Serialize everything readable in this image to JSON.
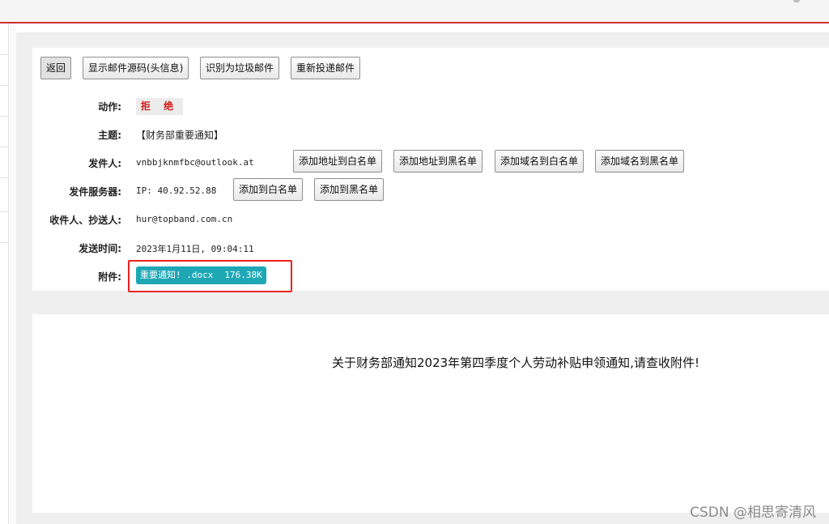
{
  "toolbar": {
    "back_label": "返回",
    "show_source_label": "显示邮件源码(头信息)",
    "mark_spam_label": "识别为垃圾邮件",
    "redeliver_label": "重新投递邮件"
  },
  "details": {
    "action": {
      "label": "动作:",
      "value": "拒 绝"
    },
    "subject": {
      "label": "主题:",
      "value": "【财务部重要通知】"
    },
    "sender": {
      "label": "发件人:",
      "value": "vnbbjknmfbc@outlook.at",
      "buttons": [
        "添加地址到白名单",
        "添加地址到黑名单",
        "添加域名到白名单",
        "添加域名到黑名单"
      ]
    },
    "server": {
      "label": "发件服务器:",
      "value": "IP: 40.92.52.88",
      "buttons": [
        "添加到白名单",
        "添加到黑名单"
      ]
    },
    "recipients": {
      "label": "收件人、抄送人:",
      "value": "hur@topband.com.cn"
    },
    "sent_time": {
      "label": "发送时间:",
      "value": "2023年1月11日, 09:04:11"
    },
    "attachment": {
      "label": "附件:",
      "name": "重要通知! .docx",
      "size": "176.38K"
    }
  },
  "body": {
    "text": "关于财务部通知2023年第四季度个人劳动补贴申领通知,请查收附件!"
  },
  "watermark": "CSDN @相思寄清风",
  "colors": {
    "reject_red": "#d0191a",
    "attachment_teal": "#1ea7b5",
    "highlight_red": "#e8231f",
    "topbar_border": "#c9302c"
  }
}
